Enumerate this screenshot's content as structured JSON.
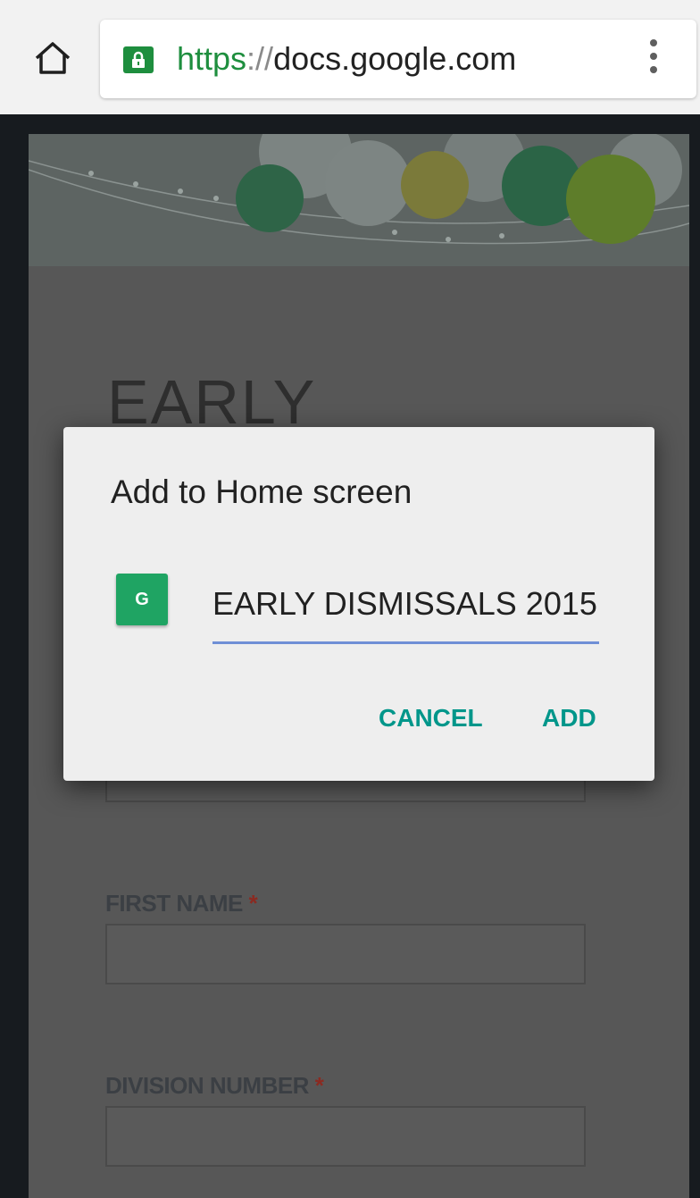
{
  "browser": {
    "url": {
      "scheme": "https",
      "separator": "://",
      "host": "docs.google.com"
    },
    "icons": {
      "home": "home-icon",
      "lock": "lock-icon",
      "menu": "overflow-menu-icon"
    },
    "colors": {
      "secure": "#1e8e3e"
    }
  },
  "form": {
    "heading": "EARLY",
    "fields": [
      {
        "label": "FIRST NAME",
        "required_mark": "*"
      },
      {
        "label": "DIVISION NUMBER",
        "required_mark": "*"
      }
    ]
  },
  "dialog": {
    "title": "Add to Home screen",
    "icon_letter": "G",
    "name_value": "EARLY DISMISSALS 2015",
    "cancel_label": "CANCEL",
    "add_label": "ADD",
    "colors": {
      "accent": "#00968a",
      "icon_bg": "#1fa463",
      "underline": "#6f8fd6"
    }
  }
}
